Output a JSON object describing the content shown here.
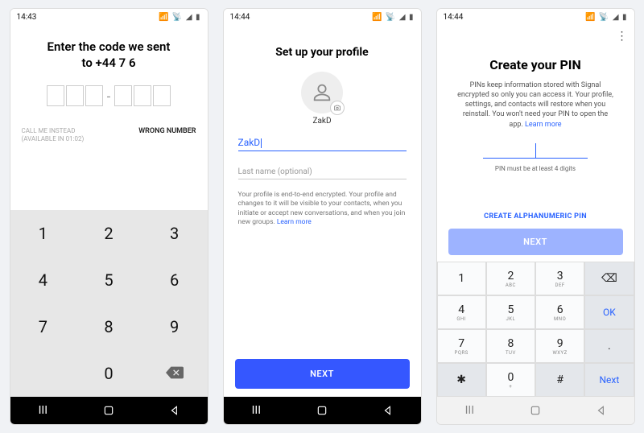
{
  "screen1": {
    "time": "14:43",
    "statusIconsLeft": "◧ ✆ ◁",
    "statusIconsRight": "📶 📡 ◢ ▮",
    "title_line1": "Enter the code we sent",
    "title_line2": "to +44 7                    6",
    "callMe_line1": "CALL ME INSTEAD",
    "callMe_line2": "(AVAILABLE IN 01:02)",
    "wrongNumber": "WRONG NUMBER",
    "keys": [
      "1",
      "2",
      "3",
      "4",
      "5",
      "6",
      "7",
      "8",
      "9",
      "",
      "0",
      "⌫"
    ]
  },
  "screen2": {
    "time": "14:44",
    "statusIconsLeft": "◧ ✆ ◁ ◌",
    "statusIconsRight": "📶 📡 ◢ ▮",
    "title": "Set up your profile",
    "displayName": "ZakD",
    "firstNameValue": "ZakD",
    "lastNamePlaceholder": "Last name (optional)",
    "desc": "Your profile is end-to-end encrypted. Your profile and changes to it will be visible to your contacts, when you initiate or accept new conversations, and when you join new groups. ",
    "learnMore": "Learn more",
    "next": "NEXT"
  },
  "screen3": {
    "time": "14:44",
    "statusIconsLeft": "◧ ■ ✆ ◌",
    "statusIconsRight": "📶 📡 ◢ ▮",
    "title": "Create your PIN",
    "desc": "PINs keep information stored with Signal encrypted so only you can access it. Your profile, settings, and contacts will restore when you reinstall. You won't need your PIN to open the app. ",
    "learnMore": "Learn more",
    "hint": "PIN must be at least 4 digits",
    "alphaLink": "CREATE ALPHANUMERIC PIN",
    "next": "NEXT",
    "keypad": [
      {
        "n": "1",
        "s": ""
      },
      {
        "n": "2",
        "s": "ABC"
      },
      {
        "n": "3",
        "s": "DEF"
      },
      {
        "n": "⌫",
        "s": "",
        "fn": true
      },
      {
        "n": "4",
        "s": "GHI"
      },
      {
        "n": "5",
        "s": "JKL"
      },
      {
        "n": "6",
        "s": "MNO"
      },
      {
        "n": "OK",
        "s": "",
        "fn": true,
        "ok": true
      },
      {
        "n": "7",
        "s": "PQRS"
      },
      {
        "n": "8",
        "s": "TUV"
      },
      {
        "n": "9",
        "s": "WXYZ"
      },
      {
        "n": ".",
        "s": "",
        "fn": true
      },
      {
        "n": "✱",
        "s": "",
        "fn": true
      },
      {
        "n": "0",
        "s": "+"
      },
      {
        "n": "#",
        "s": "",
        "fn": true
      },
      {
        "n": "Next",
        "s": "",
        "fn": true,
        "ok": true
      }
    ]
  }
}
